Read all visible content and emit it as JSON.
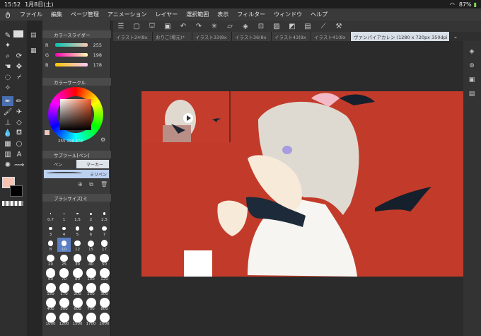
{
  "status": {
    "time": "15:52",
    "date": "1月8日(土)",
    "battery": "87%"
  },
  "menu": [
    "ファイル",
    "編集",
    "ページ管理",
    "アニメーション",
    "レイヤー",
    "選択範囲",
    "表示",
    "フィルター",
    "ウィンドウ",
    "ヘルプ"
  ],
  "tabs": [
    "イラスト24(8x",
    "おりご(場元)*",
    "イラスト33(8x",
    "イラスト36(8x",
    "イラスト43(8x",
    "イラスト41(8x",
    "ヴァンパイアカレン (1280 x 720px 350dpi 127.6%)"
  ],
  "color_slider": {
    "title": "カラースライダー",
    "r_label": "R",
    "g_label": "G",
    "b_label": "B",
    "r": "255",
    "g": "198",
    "b": "178"
  },
  "color_circle": {
    "title": "カラーサークル",
    "values": "255 198 178"
  },
  "subtool": {
    "title": "サブツール[ペン]",
    "pen_label": "ペン",
    "marker_label": "マーカー",
    "brush_name": "ミリペン"
  },
  "brush_size": {
    "title": "ブラシサイズ[ミ",
    "sizes": [
      "0.7",
      "1",
      "1.5",
      "2",
      "2.5",
      "3",
      "4",
      "5",
      "6",
      "7",
      "8",
      "10",
      "12",
      "15",
      "17",
      "20",
      "25",
      "30",
      "40",
      "50",
      "60",
      "70",
      "80",
      "100",
      "120",
      "150",
      "170",
      "200",
      "250",
      "300",
      "400",
      "500",
      "600",
      "700",
      "800",
      "1000",
      "1200",
      "1500",
      "1700",
      "2000"
    ]
  },
  "colors": {
    "accent": "#c23b2a",
    "fg_color": "#f6c3b3",
    "bg_color": "#000000"
  }
}
